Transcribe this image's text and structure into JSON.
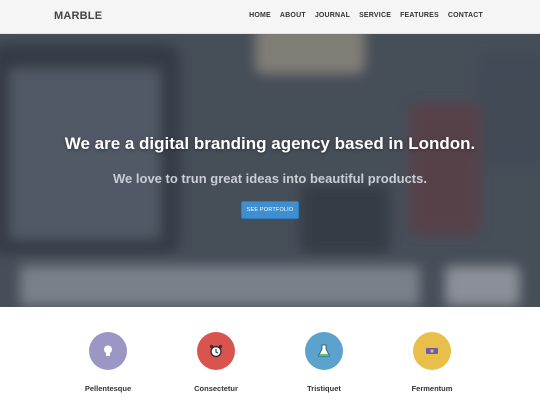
{
  "navbar": {
    "brand": "MARBLE",
    "links": [
      "HOME",
      "ABOUT",
      "JOURNAL",
      "SERVICE",
      "FEATURES",
      "CONTACT"
    ]
  },
  "hero": {
    "title": "We are a digital branding agency based in London.",
    "subtitle": "We love to trun great ideas into beautiful products.",
    "button_label": "SEE PORTFOLIO"
  },
  "features": [
    {
      "label": "Pellentesque",
      "icon": "lightbulb-icon",
      "color": "#9b97c4"
    },
    {
      "label": "Consectetur",
      "icon": "alarm-clock-icon",
      "color": "#d9534f"
    },
    {
      "label": "Tristiquet",
      "icon": "flask-icon",
      "color": "#5ba3cc"
    },
    {
      "label": "Fermentum",
      "icon": "ticket-icon",
      "color": "#e8bf4a"
    }
  ]
}
